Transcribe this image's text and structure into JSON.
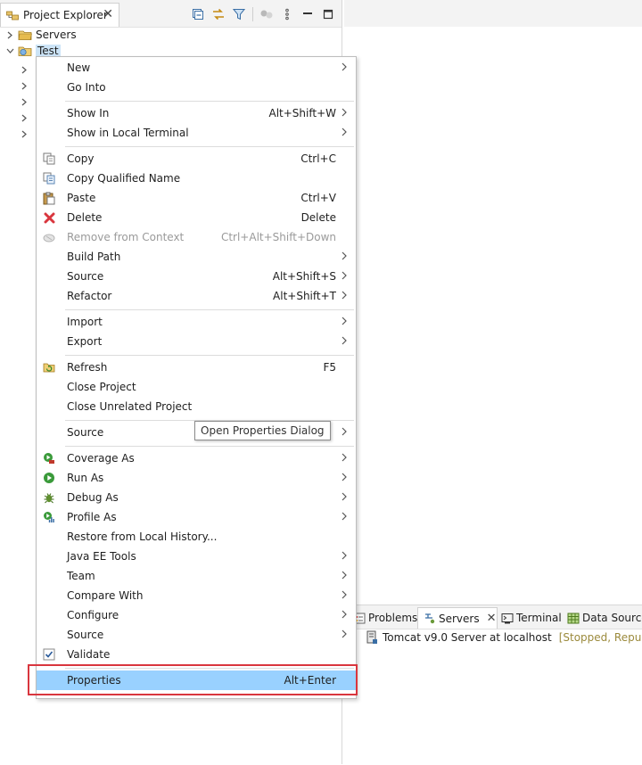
{
  "explorer": {
    "tab_title": "Project Explorer",
    "tree": [
      {
        "label": "Servers",
        "expanded": false
      },
      {
        "label": "Test",
        "expanded": true,
        "selected": true
      }
    ]
  },
  "context_menu": {
    "items": [
      {
        "label": "New",
        "accel": "",
        "submenu": true
      },
      {
        "label": "Go Into",
        "accel": "",
        "submenu": false
      },
      {
        "label": "Show In",
        "accel": "Alt+Shift+W",
        "submenu": true
      },
      {
        "label": "Show in Local Terminal",
        "accel": "",
        "submenu": true
      },
      {
        "label": "Copy",
        "accel": "Ctrl+C",
        "submenu": false,
        "icon": "copy-icon"
      },
      {
        "label": "Copy Qualified Name",
        "accel": "",
        "submenu": false,
        "icon": "copy-qualified-name-icon"
      },
      {
        "label": "Paste",
        "accel": "Ctrl+V",
        "submenu": false,
        "icon": "paste-icon"
      },
      {
        "label": "Delete",
        "accel": "Delete",
        "submenu": false,
        "icon": "delete-icon"
      },
      {
        "label": "Remove from Context",
        "accel": "Ctrl+Alt+Shift+Down",
        "submenu": false,
        "disabled": true,
        "icon": "remove-context-icon"
      },
      {
        "label": "Build Path",
        "accel": "",
        "submenu": true
      },
      {
        "label": "Source",
        "accel": "Alt+Shift+S",
        "submenu": true
      },
      {
        "label": "Refactor",
        "accel": "Alt+Shift+T",
        "submenu": true
      },
      {
        "label": "Import",
        "accel": "",
        "submenu": true
      },
      {
        "label": "Export",
        "accel": "",
        "submenu": true
      },
      {
        "label": "Refresh",
        "accel": "F5",
        "submenu": false,
        "icon": "refresh-icon"
      },
      {
        "label": "Close Project",
        "accel": "",
        "submenu": false
      },
      {
        "label": "Close Unrelated Project",
        "accel": "",
        "submenu": false
      },
      {
        "label": "Source",
        "accel": "",
        "submenu": true
      },
      {
        "label": "Coverage As",
        "accel": "",
        "submenu": true,
        "icon": "coverage-icon"
      },
      {
        "label": "Run As",
        "accel": "",
        "submenu": true,
        "icon": "run-icon"
      },
      {
        "label": "Debug As",
        "accel": "",
        "submenu": true,
        "icon": "debug-icon"
      },
      {
        "label": "Profile As",
        "accel": "",
        "submenu": true,
        "icon": "profile-icon"
      },
      {
        "label": "Restore from Local History...",
        "accel": "",
        "submenu": false
      },
      {
        "label": "Java EE Tools",
        "accel": "",
        "submenu": true
      },
      {
        "label": "Team",
        "accel": "",
        "submenu": true
      },
      {
        "label": "Compare With",
        "accel": "",
        "submenu": true
      },
      {
        "label": "Configure",
        "accel": "",
        "submenu": true
      },
      {
        "label": "Source",
        "accel": "",
        "submenu": true
      },
      {
        "label": "Validate",
        "accel": "",
        "submenu": false,
        "icon": "validate-check-icon"
      },
      {
        "label": "Properties",
        "accel": "Alt+Enter",
        "submenu": false,
        "highlighted": true
      }
    ],
    "tooltip": "Open Properties Dialog"
  },
  "bottom_panel": {
    "tabs": [
      {
        "label": "Problems"
      },
      {
        "label": "Servers",
        "active": true
      },
      {
        "label": "Terminal"
      },
      {
        "label": "Data Source"
      }
    ],
    "server_row": {
      "name": "Tomcat v9.0 Server at localhost",
      "status": "[Stopped, Republish]"
    }
  },
  "colors": {
    "highlight": "#99d1ff",
    "selection": "#cce4f7",
    "annotation_box": "#d9363e",
    "status_text": "#9b8a3c"
  }
}
